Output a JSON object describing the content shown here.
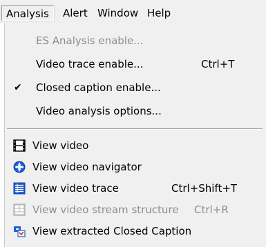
{
  "menubar": {
    "items": [
      "Analysis",
      "Alert",
      "Window",
      "Help"
    ],
    "active": "Analysis"
  },
  "menu": {
    "items": [
      {
        "label": "ES Analysis enable...",
        "shortcut": "",
        "enabled": false,
        "checked": false,
        "icon": ""
      },
      {
        "label": "Video trace enable...",
        "shortcut": "Ctrl+T",
        "enabled": true,
        "checked": false,
        "icon": ""
      },
      {
        "label": "Closed caption enable...",
        "shortcut": "",
        "enabled": true,
        "checked": true,
        "icon": "checkmark-icon"
      },
      {
        "label": "Video analysis options...",
        "shortcut": "",
        "enabled": true,
        "checked": false,
        "icon": ""
      },
      {
        "label": "View video",
        "shortcut": "",
        "enabled": true,
        "checked": false,
        "icon": "film-strip-icon"
      },
      {
        "label": "View video navigator",
        "shortcut": "",
        "enabled": true,
        "checked": false,
        "icon": "navigator-icon"
      },
      {
        "label": "View video trace",
        "shortcut": "Ctrl+Shift+T",
        "enabled": true,
        "checked": false,
        "icon": "trace-list-icon"
      },
      {
        "label": "View video stream structure",
        "shortcut": "Ctrl+R",
        "enabled": false,
        "checked": false,
        "icon": "stream-structure-icon"
      },
      {
        "label": "View extracted Closed Caption",
        "shortcut": "",
        "enabled": true,
        "checked": false,
        "icon": "closed-caption-icon"
      }
    ]
  },
  "colors": {
    "menu_bg": "#f0f0f0",
    "disabled_text": "#8d8d8d",
    "separator": "#a0a0a0",
    "icon_blue": "#1c5fd8"
  }
}
